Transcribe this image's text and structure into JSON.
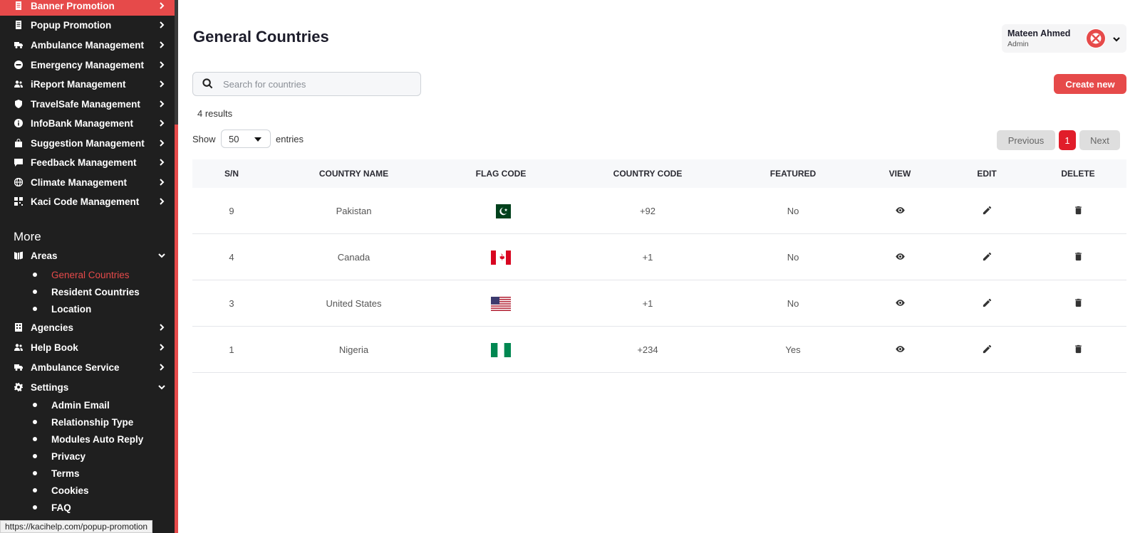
{
  "sidebar": {
    "items": [
      {
        "label": "Banner Promotion",
        "icon": "document-icon"
      },
      {
        "label": "Popup Promotion",
        "icon": "document-icon"
      },
      {
        "label": "Ambulance Management",
        "icon": "truck-icon"
      },
      {
        "label": "Emergency Management",
        "icon": "emergency-icon"
      },
      {
        "label": "iReport Management",
        "icon": "users-icon"
      },
      {
        "label": "TravelSafe Management",
        "icon": "shield-icon"
      },
      {
        "label": "InfoBank Management",
        "icon": "info-icon"
      },
      {
        "label": "Suggestion Management",
        "icon": "bag-icon"
      },
      {
        "label": "Feedback Management",
        "icon": "message-icon"
      },
      {
        "label": "Climate Management",
        "icon": "globe-icon"
      },
      {
        "label": "Kaci Code Management",
        "icon": "grid-icon"
      }
    ],
    "more_title": "More",
    "areas": {
      "label": "Areas",
      "children": [
        "General Countries",
        "Resident Countries",
        "Location"
      ]
    },
    "more_items": [
      {
        "label": "Agencies",
        "icon": "building-icon"
      },
      {
        "label": "Help Book",
        "icon": "users-icon"
      },
      {
        "label": "Ambulance Service",
        "icon": "truck-icon"
      }
    ],
    "settings": {
      "label": "Settings",
      "children": [
        "Admin Email",
        "Relationship Type",
        "Modules Auto Reply",
        "Privacy",
        "Terms",
        "Cookies",
        "FAQ"
      ]
    }
  },
  "status_url": "https://kacihelp.com/popup-promotion",
  "header": {
    "title": "General Countries"
  },
  "user": {
    "name": "Mateen Ahmed",
    "role": "Admin"
  },
  "search": {
    "placeholder": "Search for countries",
    "value": ""
  },
  "create_button": "Create new",
  "results_text": "4 results",
  "entries": {
    "show_label": "Show",
    "value": "50",
    "suffix": "entries"
  },
  "pagination": {
    "previous": "Previous",
    "current": "1",
    "next": "Next"
  },
  "table": {
    "columns": [
      "S/N",
      "COUNTRY NAME",
      "FLAG CODE",
      "COUNTRY CODE",
      "FEATURED",
      "VIEW",
      "EDIT",
      "DELETE"
    ],
    "rows": [
      {
        "sn": "9",
        "name": "Pakistan",
        "flag": "pakistan-flag",
        "code": "+92",
        "featured": "No"
      },
      {
        "sn": "4",
        "name": "Canada",
        "flag": "canada-flag",
        "code": "+1",
        "featured": "No"
      },
      {
        "sn": "3",
        "name": "United States",
        "flag": "usa-flag",
        "code": "+1",
        "featured": "No"
      },
      {
        "sn": "1",
        "name": "Nigeria",
        "flag": "nigeria-flag",
        "code": "+234",
        "featured": "Yes"
      }
    ]
  },
  "colors": {
    "accent": "#e64a4a",
    "sidebar_bg": "#1f1f1f",
    "page_active": "#e11d2a"
  }
}
